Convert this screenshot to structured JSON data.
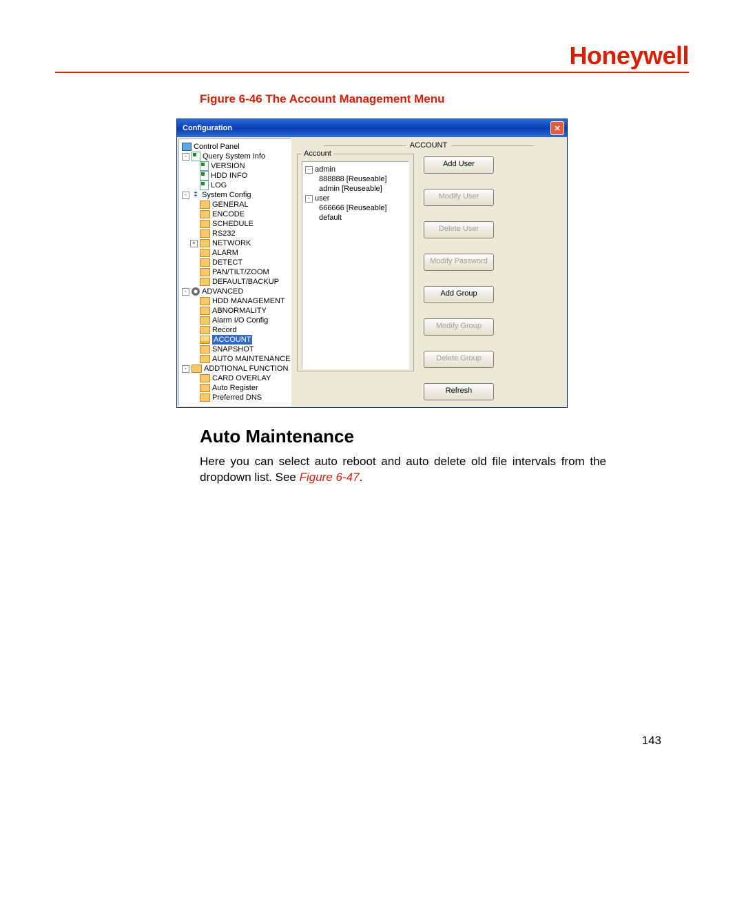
{
  "brand": "Honeywell",
  "figure_caption": "Figure 6-46 The Account Management Menu",
  "window": {
    "title": "Configuration",
    "close_glyph": "✕",
    "panel_header": "ACCOUNT",
    "fieldset_label": "Account"
  },
  "tree": {
    "control_panel": "Control Panel",
    "query": "Query System Info",
    "version": "VERSION",
    "hdd_info": "HDD INFO",
    "log": "LOG",
    "system_config": "System Config",
    "general": "GENERAL",
    "encode": "ENCODE",
    "schedule": "SCHEDULE",
    "rs232": "RS232",
    "network": "NETWORK",
    "alarm": "ALARM",
    "detect": "DETECT",
    "ptz": "PAN/TILT/ZOOM",
    "default_backup": "DEFAULT/BACKUP",
    "advanced": "ADVANCED",
    "hdd_mgmt": "HDD MANAGEMENT",
    "abnormality": "ABNORMALITY",
    "alarm_io": "Alarm I/O Config",
    "record": "Record",
    "account": "ACCOUNT",
    "snapshot": "SNAPSHOT",
    "auto_maint": "AUTO MAINTENANCE",
    "addl_func": "ADDTIONAL FUNCTION",
    "card_overlay": "CARD OVERLAY",
    "auto_register": "Auto Register",
    "pref_dns": "Preferred DNS"
  },
  "accounts": {
    "admin_group": "admin",
    "admin_1": "888888 [Reuseable]",
    "admin_2": "admin [Reuseable]",
    "user_group": "user",
    "user_1": "666666 [Reuseable]",
    "user_2": "default"
  },
  "buttons": {
    "add_user": "Add User",
    "modify_user": "Modify User",
    "delete_user": "Delete User",
    "modify_password": "Modify Password",
    "add_group": "Add Group",
    "modify_group": "Modify Group",
    "delete_group": "Delete Group",
    "refresh": "Refresh"
  },
  "section_heading": "Auto Maintenance",
  "body_text_1": "Here you can select auto reboot and auto delete old file intervals from the dropdown list. See ",
  "body_ref": "Figure 6-47",
  "body_text_2": ".",
  "page_number": "143"
}
